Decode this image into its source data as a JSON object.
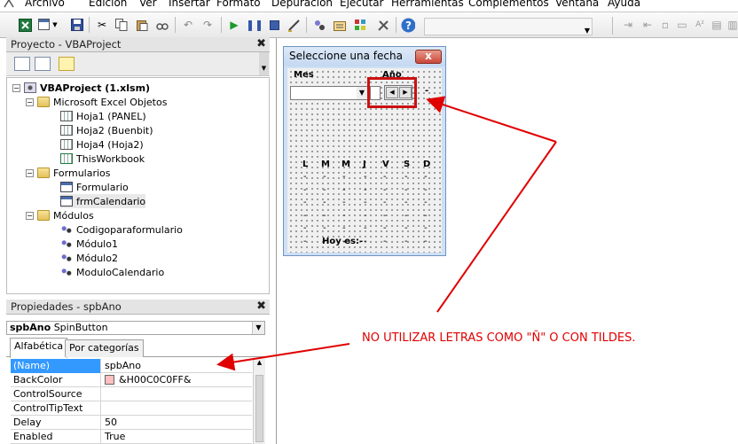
{
  "menu": [
    "Archivo",
    "Edición",
    "Ver",
    "Insertar",
    "Formato",
    "Depuración",
    "Ejecutar",
    "Herramientas",
    "Complementos",
    "Ventana",
    "Ayuda"
  ],
  "toolbar": {
    "icons": [
      "excel-icon",
      "insert-userform-icon",
      "save-icon",
      "cut-icon",
      "copy-icon",
      "paste-icon",
      "find-icon",
      "undo-icon",
      "redo-icon",
      "run-icon",
      "break-icon",
      "reset-icon",
      "design-mode-icon",
      "project-explorer-icon",
      "properties-icon",
      "object-browser-icon",
      "toolbox-icon",
      "help-icon"
    ],
    "right_icons": [
      "indent-icon",
      "outdent-icon",
      "toggle-breakpoint-icon",
      "comment-block-icon",
      "font-size-icon",
      "quick-info-icon",
      "parameter-info-icon",
      "complete-word-icon"
    ]
  },
  "project": {
    "title": "Proyecto - VBAProject",
    "tree": [
      {
        "label": "VBAProject (1.xlsm)",
        "bold": true
      },
      {
        "label": "Microsoft Excel Objetos"
      },
      {
        "label": "Hoja1 (PANEL)"
      },
      {
        "label": "Hoja2 (Buenbit)"
      },
      {
        "label": "Hoja4 (Hoja2)"
      },
      {
        "label": "ThisWorkbook"
      },
      {
        "label": "Formularios"
      },
      {
        "label": "Formulario"
      },
      {
        "label": "frmCalendario"
      },
      {
        "label": "Módulos"
      },
      {
        "label": "Codigoparaformulario"
      },
      {
        "label": "Módulo1"
      },
      {
        "label": "Módulo2"
      },
      {
        "label": "ModuloCalendario"
      }
    ]
  },
  "properties": {
    "title": "Propiedades - spbAno",
    "object_name": "spbAno",
    "object_type": "SpinButton",
    "tabs": [
      "Alfabética",
      "Por categorías"
    ],
    "rows": [
      {
        "name": "(Name)",
        "value": "spbAno"
      },
      {
        "name": "BackColor",
        "value": "&H00C0C0FF&"
      },
      {
        "name": "ControlSource",
        "value": ""
      },
      {
        "name": "ControlTipText",
        "value": ""
      },
      {
        "name": "Delay",
        "value": "50"
      },
      {
        "name": "Enabled",
        "value": "True"
      }
    ],
    "backcolor_swatch": "#ffc0c0"
  },
  "userform": {
    "title": "Seleccione una fecha",
    "close": "x",
    "lbl_mes": "Mes",
    "lbl_ano": "Año",
    "days": [
      "L",
      "M",
      "M",
      "J",
      "V",
      "S",
      "D"
    ],
    "hoy_label": "Hoy es:",
    "hoy_value": "-",
    "dash": "-"
  },
  "annotation": {
    "text": "NO UTILIZAR LETRAS COMO \"Ñ\" O CON TILDES.",
    "color": "#e00000"
  }
}
